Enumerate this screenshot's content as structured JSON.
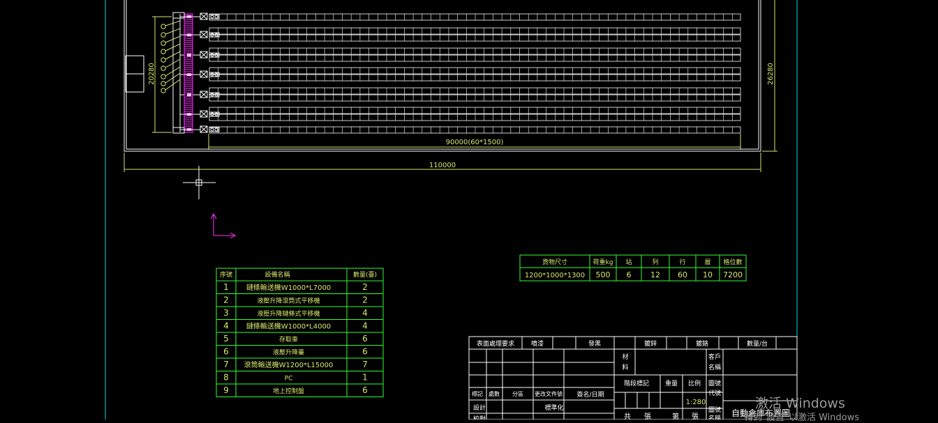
{
  "dimensions": {
    "width_90000": "90000(60*1500)",
    "width_110000": "110000",
    "height_left": "20280",
    "height_right": "26280"
  },
  "equipment_table": {
    "headers": [
      "序號",
      "設備名稱",
      "數量(臺)"
    ],
    "rows": [
      [
        "1",
        "鏈條輸送機W1000*L7000",
        "2"
      ],
      [
        "2",
        "液壓升降滾筒式平移機",
        "2"
      ],
      [
        "3",
        "液壓升降鏈條式平移機",
        "4"
      ],
      [
        "4",
        "鏈條輸送機W1000*L4000",
        "4"
      ],
      [
        "5",
        "存取車",
        "6"
      ],
      [
        "6",
        "液壓升降臺",
        "6"
      ],
      [
        "7",
        "滾筒輸送機W1200*L15000",
        "7"
      ],
      [
        "8",
        "PC",
        "1"
      ],
      [
        "9",
        "地上控制盤",
        "6"
      ]
    ]
  },
  "spec_table": {
    "headers": [
      "貨物尺寸",
      "荷重kg",
      "站",
      "列",
      "行",
      "層",
      "格位數"
    ],
    "values": [
      "1200*1000*1300",
      "500",
      "6",
      "12",
      "60",
      "10",
      "7200"
    ]
  },
  "title_block": {
    "surface_treatment": "表面處理要求",
    "spray_paint": "噴漆",
    "blackening": "發黑",
    "galvanize": "鍍鋅",
    "chrome": "鍍鉻",
    "qty_per_set": "數量/台",
    "material": [
      "材",
      "料"
    ],
    "customer_name": [
      "客戶",
      "名稱"
    ],
    "stage_mark": "階段標記",
    "weight": "重量",
    "scale": "比例",
    "drawing_code": [
      "圖號",
      "代號"
    ],
    "scale_value": "1:280",
    "mark": "標記",
    "count": "處數",
    "zone": "分區",
    "change_doc": "更改文件號",
    "sign_date": "簽名/日期",
    "design": "設計",
    "standardize": "標準化",
    "bottom_row": [
      "共",
      "張",
      "第",
      "張"
    ],
    "drawing_name": [
      "圖號",
      "名稱"
    ],
    "drawing_title": "自動倉庫布置圖",
    "proofread": "校對"
  },
  "watermark": {
    "line1": "激活 Windows",
    "line2": "轉到\"設置\"以激活 Windows"
  },
  "colors": {
    "background": "#000000",
    "frame": "#00e0e0",
    "lines": "#d8e86a",
    "green_table": "#33ff33",
    "magenta": "#ff33ff",
    "white": "#ffffff"
  }
}
